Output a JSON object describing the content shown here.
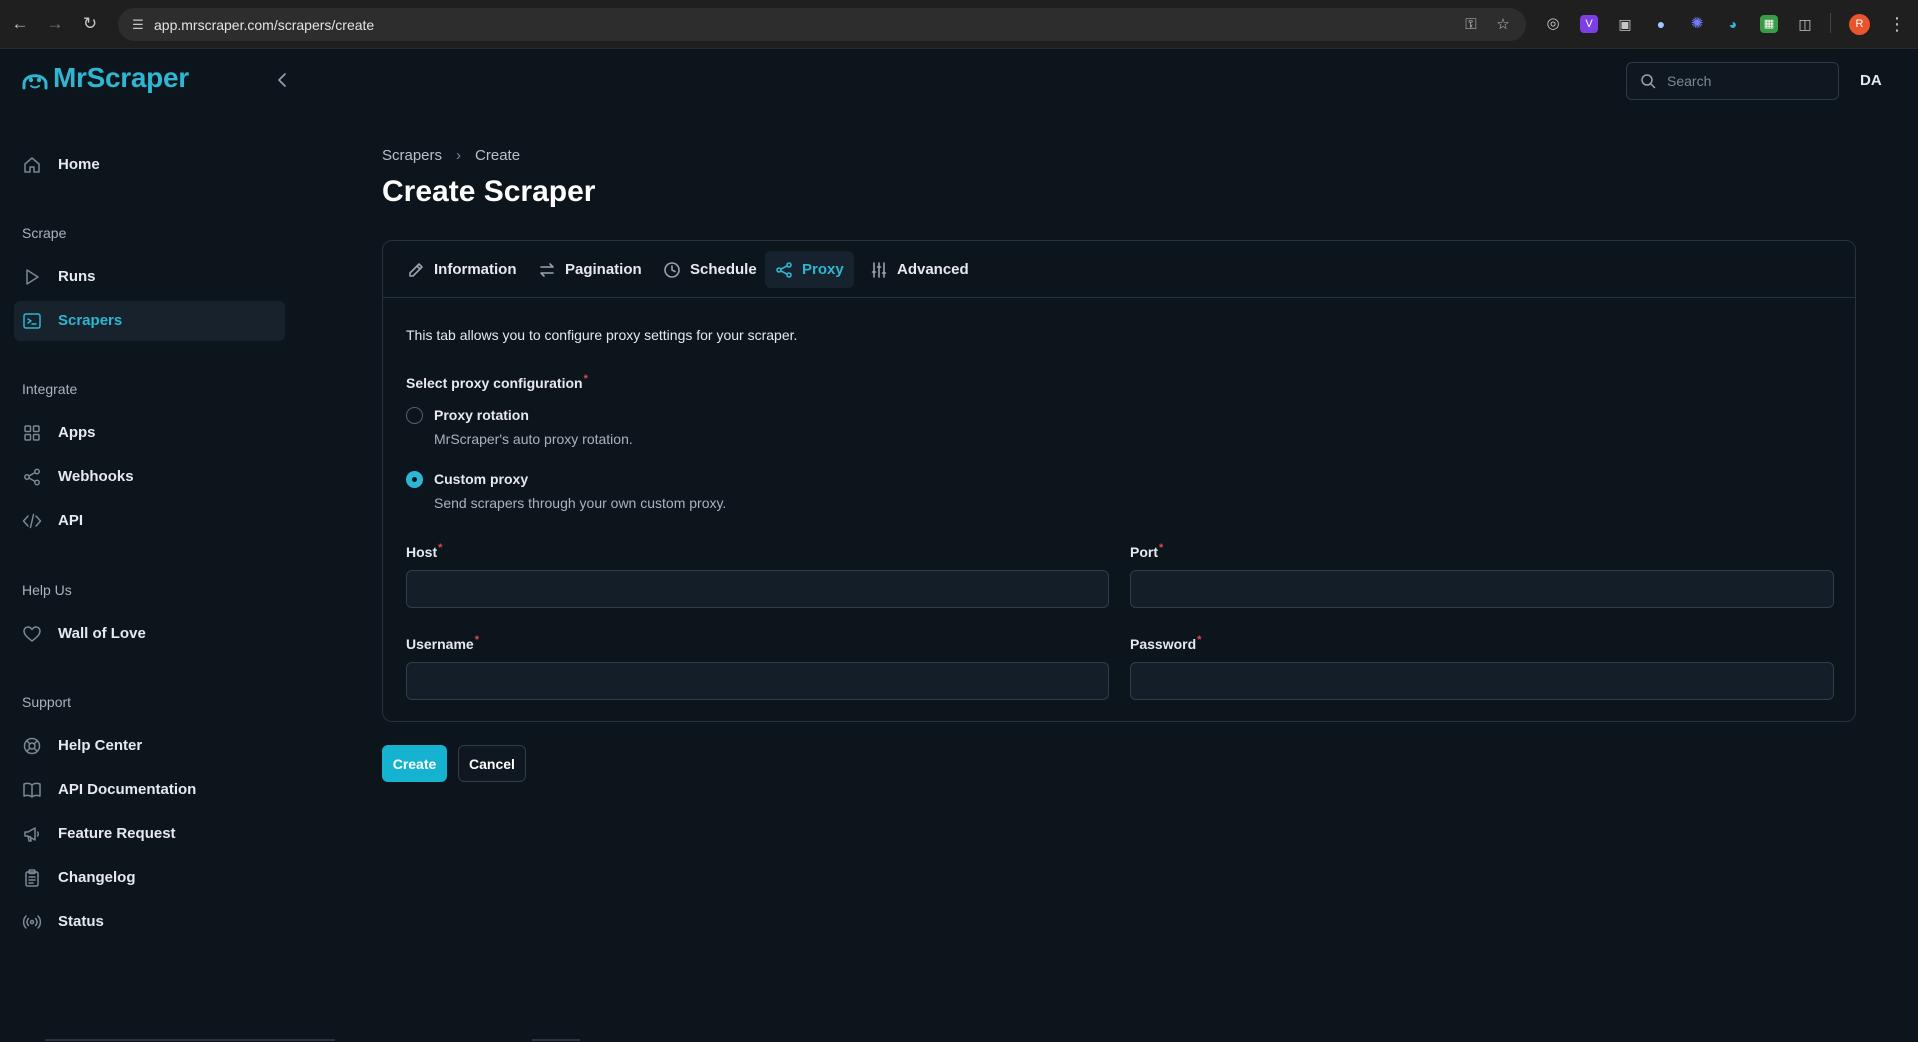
{
  "browser": {
    "url": "app.mrscraper.com/scrapers/create",
    "profile_initial": "R"
  },
  "app": {
    "brand": "MrScraper",
    "search_placeholder": "Search",
    "user_initials": "DA"
  },
  "sidebar": {
    "home": "Home",
    "sections": {
      "scrape": "Scrape",
      "integrate": "Integrate",
      "help_us": "Help Us",
      "support": "Support"
    },
    "items": {
      "runs": "Runs",
      "scrapers": "Scrapers",
      "apps": "Apps",
      "webhooks": "Webhooks",
      "api": "API",
      "wall_of_love": "Wall of Love",
      "help_center": "Help Center",
      "api_documentation": "API Documentation",
      "feature_request": "Feature Request",
      "changelog": "Changelog",
      "status": "Status"
    },
    "active_item": "scrapers"
  },
  "breadcrumb": {
    "parent": "Scrapers",
    "current": "Create"
  },
  "page": {
    "title": "Create Scraper"
  },
  "tabs": {
    "information": "Information",
    "pagination": "Pagination",
    "schedule": "Schedule",
    "proxy": "Proxy",
    "advanced": "Advanced",
    "active": "proxy"
  },
  "proxy_tab": {
    "description": "This tab allows you to configure proxy settings for your scraper.",
    "select_label": "Select proxy configuration",
    "options": [
      {
        "title": "Proxy rotation",
        "description": "MrScraper's auto proxy rotation.",
        "selected": false
      },
      {
        "title": "Custom proxy",
        "description": "Send scrapers through your own custom proxy.",
        "selected": true
      }
    ],
    "fields": {
      "host": {
        "label": "Host",
        "value": ""
      },
      "port": {
        "label": "Port",
        "value": ""
      },
      "username": {
        "label": "Username",
        "value": ""
      },
      "password": {
        "label": "Password",
        "value": ""
      }
    }
  },
  "actions": {
    "create": "Create",
    "cancel": "Cancel"
  },
  "colors": {
    "accent": "#2eb6d2",
    "background": "#0c141c",
    "required": "#e5484d"
  }
}
